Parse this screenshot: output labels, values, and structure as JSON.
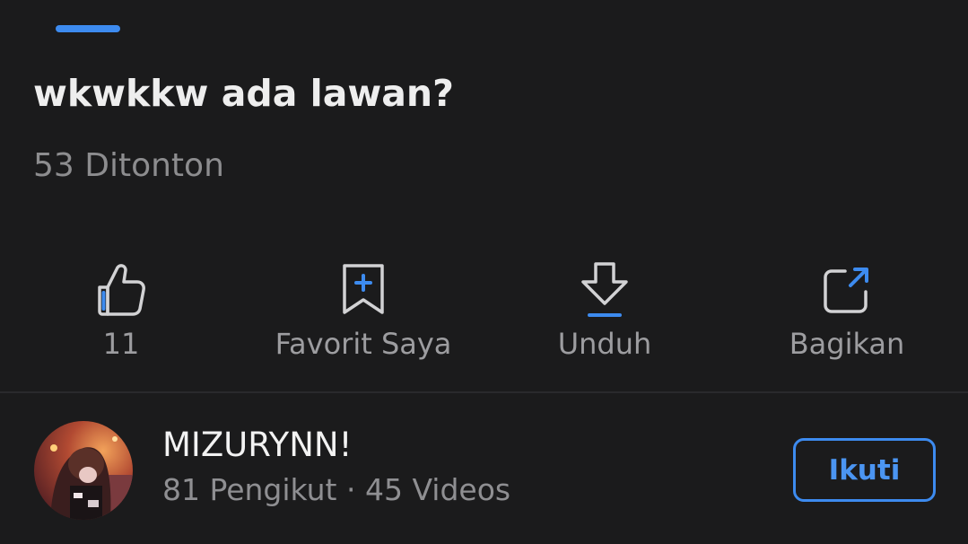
{
  "video": {
    "title": "wkwkkw ada lawan?",
    "views": "53 Ditonton"
  },
  "actions": [
    {
      "icon": "thumbs-up-icon",
      "label": "11"
    },
    {
      "icon": "bookmark-add-icon",
      "label": "Favorit Saya"
    },
    {
      "icon": "download-icon",
      "label": "Unduh"
    },
    {
      "icon": "share-icon",
      "label": "Bagikan"
    }
  ],
  "channel": {
    "name": "MIZURYNN!",
    "meta": "81 Pengikut · 45 Videos",
    "follow_label": "Ikuti"
  },
  "colors": {
    "accent": "#3d8bef",
    "background": "#1b1b1c",
    "icon_stroke": "#d2d2d4",
    "secondary_text": "#8d8d8f"
  }
}
